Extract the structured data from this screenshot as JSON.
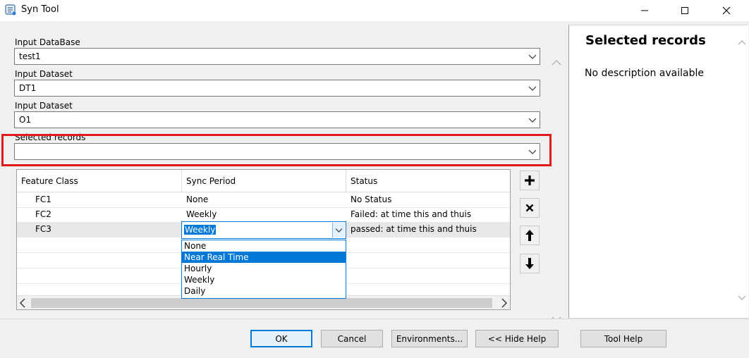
{
  "window": {
    "title": "Syn Tool",
    "icon": "scroll-tool-icon"
  },
  "form": {
    "fields": [
      {
        "label": "Input DataBase",
        "value": "test1"
      },
      {
        "label": "Input Dataset",
        "value": "DT1"
      },
      {
        "label": "Input Dataset",
        "value": "O1"
      },
      {
        "label": "Selected records",
        "value": ""
      }
    ]
  },
  "grid": {
    "columns": [
      "Feature Class",
      "Sync Period",
      "Status"
    ],
    "rows": [
      {
        "feature_class": "FC1",
        "sync_period": "None",
        "status": "No Status"
      },
      {
        "feature_class": "FC2",
        "sync_period": "Weekly",
        "status": "Failed: at time this and thuis"
      },
      {
        "feature_class": "FC3",
        "sync_period": "Weekly",
        "status": "passed: at time this and thuis"
      }
    ],
    "editor": {
      "selected": "Weekly",
      "options": [
        "None",
        "Near Real Time",
        "Hourly",
        "Weekly",
        "Daily"
      ],
      "highlighted": "Near Real Time"
    }
  },
  "side_buttons": [
    "add-icon",
    "delete-icon",
    "move-up-icon",
    "move-down-icon"
  ],
  "help": {
    "title": "Selected records",
    "description": "No description available"
  },
  "buttons": {
    "ok": "OK",
    "cancel": "Cancel",
    "environments": "Environments...",
    "hide_help": "<< Hide Help",
    "tool_help": "Tool Help"
  },
  "colors": {
    "accent": "#0078d7",
    "highlight_border": "#e01b1b",
    "selection": "#0078d7"
  }
}
